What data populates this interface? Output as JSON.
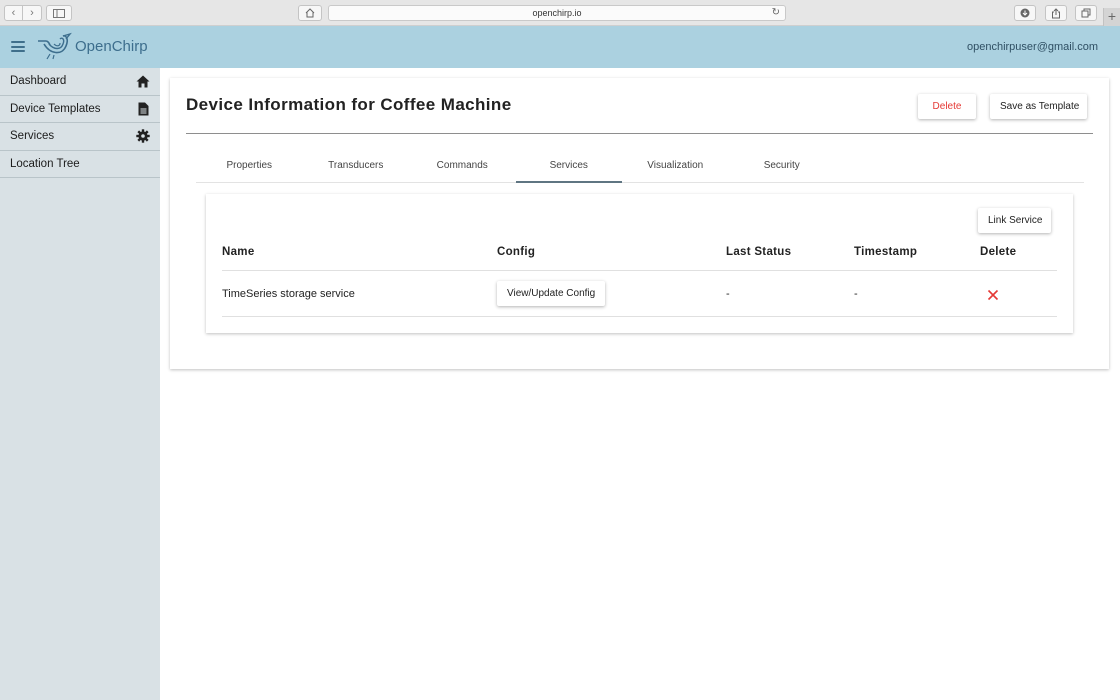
{
  "browser": {
    "url": "openchirp.io",
    "icons": [
      "back-icon",
      "forward-icon",
      "sidebar-icon",
      "home-icon",
      "reload-icon",
      "download-icon",
      "share-icon",
      "tabs-icon",
      "new-tab-icon"
    ]
  },
  "header": {
    "app_name": "OpenChirp",
    "user_email": "openchirpuser@gmail.com",
    "brand_color": "#abd1e0"
  },
  "sidebar": {
    "items": [
      {
        "label": "Dashboard",
        "icon": "home-icon"
      },
      {
        "label": "Device Templates",
        "icon": "document-icon"
      },
      {
        "label": "Services",
        "icon": "gear-icon"
      },
      {
        "label": "Location Tree",
        "icon": ""
      }
    ]
  },
  "page": {
    "title": "Device Information for Coffee Machine",
    "delete_label": "Delete",
    "save_template_label": "Save as Template",
    "tabs": [
      {
        "label": "Properties",
        "active": false
      },
      {
        "label": "Transducers",
        "active": false
      },
      {
        "label": "Commands",
        "active": false
      },
      {
        "label": "Services",
        "active": true
      },
      {
        "label": "Visualization",
        "active": false
      },
      {
        "label": "Security",
        "active": false
      }
    ]
  },
  "services": {
    "link_label": "Link Service",
    "columns": [
      "Name",
      "Config",
      "Last Status",
      "Timestamp",
      "Delete"
    ],
    "rows": [
      {
        "name": "TimeSeries storage service",
        "config_label": "View/Update Config",
        "last_status": "-",
        "timestamp": "-",
        "delete_icon": "close-icon"
      }
    ],
    "delete_color": "#e53935"
  }
}
